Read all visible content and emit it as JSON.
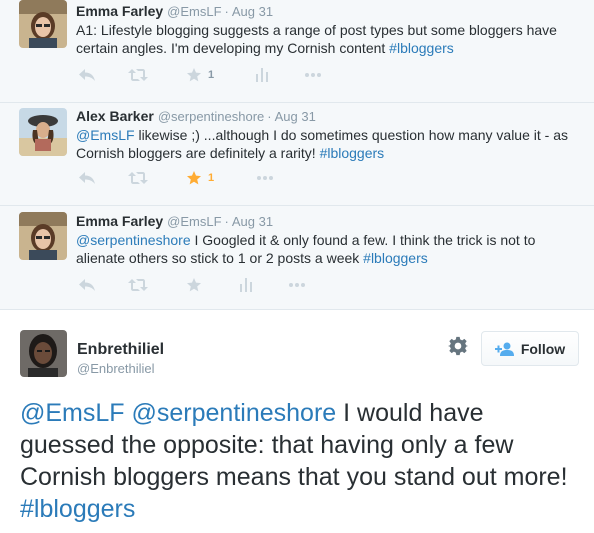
{
  "replies": [
    {
      "name": "Emma Farley",
      "handle": "@EmsLF",
      "date": "Aug 31",
      "text_plain": "A1: Lifestyle blogging suggests a range of post types but some bloggers have certain angles. I'm developing my Cornish content ",
      "hashtag": "#lbloggers",
      "favorite_count": "1",
      "favorited": false
    },
    {
      "name": "Alex Barker",
      "handle": "@serpentineshore",
      "date": "Aug 31",
      "mention": "@EmsLF",
      "text_plain": " likewise ;) ...although I do sometimes question how many value it - as Cornish bloggers are definitely a rarity! ",
      "hashtag": "#lbloggers",
      "favorite_count": "1",
      "favorited": true
    },
    {
      "name": "Emma Farley",
      "handle": "@EmsLF",
      "date": "Aug 31",
      "mention": "@serpentineshore",
      "text_plain": " I Googled it & only found a few. I think the trick is not to alienate others so stick to 1 or 2 posts a week ",
      "hashtag": "#lbloggers",
      "favorite_count": "",
      "favorited": false
    }
  ],
  "main_tweet": {
    "name": "Enbrethiliel",
    "handle": "@Enbrethiliel",
    "follow_label": "Follow",
    "mention1": "@EmsLF",
    "mention2": "@serpentineshore",
    "text_plain": " I would have guessed the opposite: that having only a few Cornish bloggers means that you stand out more! ",
    "hashtag": "#lbloggers"
  },
  "colors": {
    "link": "#2b7bb9",
    "muted": "#8899a6",
    "favorite": "#ffac33",
    "thread_bg": "#f5f8fa"
  }
}
